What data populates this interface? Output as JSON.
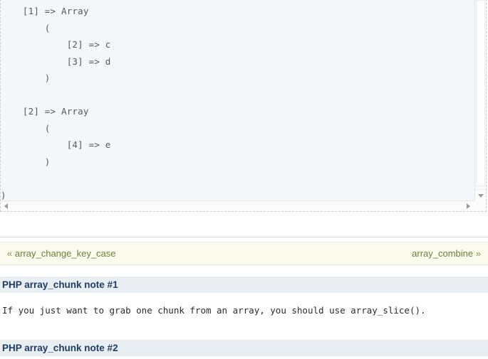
{
  "code_panel": {
    "output_text": "    [1] => Array\n        (\n            [2] => c\n            [3] => d\n        )\n\n    [2] => Array\n        (\n            [4] => e\n        )\n\n)",
    "scrollbars": {
      "vertical_down_arrow": "chevron-down-icon",
      "horizontal_left_arrow": "chevron-left-icon",
      "horizontal_right_arrow": "chevron-right-icon"
    }
  },
  "nav": {
    "prev_label": "array_change_key_case",
    "prev_chevron": "«",
    "next_label": "array_combine",
    "next_chevron": "»",
    "accent_color": "#6b7f3e",
    "background_color": "#fbfbee"
  },
  "notes": [
    {
      "heading": "PHP array_chunk note #1",
      "body": "If you just want to grab one chunk from an array, you should use array_slice()."
    },
    {
      "heading": "PHP array_chunk note #2",
      "body": ""
    }
  ],
  "colors": {
    "note_heading_bg": "#e9eef3",
    "note_heading_text": "#1f3c63",
    "code_bg": "#f4f7f9",
    "code_text": "#58585a"
  }
}
